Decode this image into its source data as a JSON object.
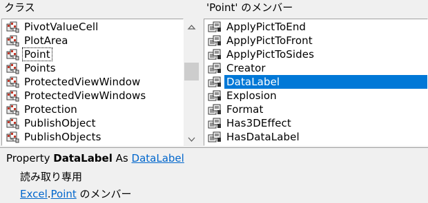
{
  "left_panel": {
    "header": "クラス",
    "items": [
      {
        "label": "PivotValueCell"
      },
      {
        "label": "PlotArea"
      },
      {
        "label": "Point",
        "focused": true
      },
      {
        "label": "Points"
      },
      {
        "label": "ProtectedViewWindow"
      },
      {
        "label": "ProtectedViewWindows"
      },
      {
        "label": "Protection"
      },
      {
        "label": "PublishObject"
      },
      {
        "label": "PublishObjects"
      }
    ]
  },
  "right_panel": {
    "header": "'Point' のメンバー",
    "items": [
      {
        "label": "ApplyPictToEnd"
      },
      {
        "label": "ApplyPictToFront"
      },
      {
        "label": "ApplyPictToSides"
      },
      {
        "label": "Creator"
      },
      {
        "label": "DataLabel",
        "selected": true
      },
      {
        "label": "Explosion"
      },
      {
        "label": "Format"
      },
      {
        "label": "Has3DEffect"
      },
      {
        "label": "HasDataLabel"
      }
    ]
  },
  "details": {
    "kind": "Property",
    "name": "DataLabel",
    "as_word": "As",
    "type_link": "DataLabel",
    "access": "読み取り専用",
    "library_link": "Excel",
    "dot": ".",
    "class_link": "Point",
    "member_suffix": "のメンバー"
  },
  "colors": {
    "selection": "#0078d7",
    "link": "#0066cc"
  },
  "icons": {
    "class_item": "class-icon",
    "member_item": "property-icon"
  }
}
